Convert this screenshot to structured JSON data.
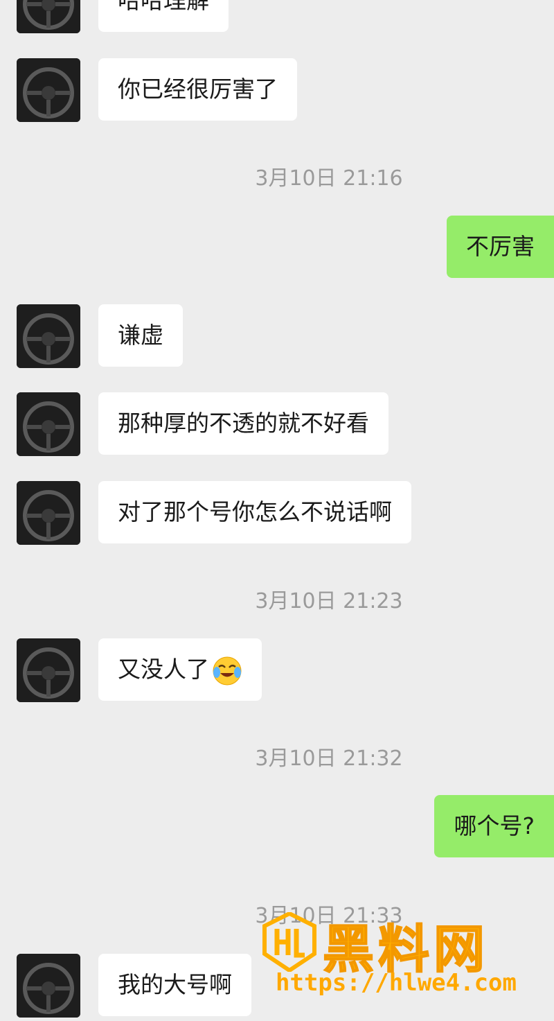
{
  "messages": [
    {
      "side": "other",
      "text": "哈哈理解"
    },
    {
      "side": "other",
      "text": "你已经很厉害了"
    },
    {
      "side": "time",
      "text": "3月10日 21:16"
    },
    {
      "side": "self",
      "text": "不厉害"
    },
    {
      "side": "other",
      "text": "谦虚"
    },
    {
      "side": "other",
      "text": "那种厚的不透的就不好看"
    },
    {
      "side": "other",
      "text": "对了那个号你怎么不说话啊"
    },
    {
      "side": "time",
      "text": "3月10日 21:23"
    },
    {
      "side": "other",
      "text": "又没人了",
      "emoji": "crying-laughing-emoji"
    },
    {
      "side": "time",
      "text": "3月10日 21:32"
    },
    {
      "side": "self",
      "text": "哪个号?"
    },
    {
      "side": "time",
      "text": "3月10日 21:33"
    },
    {
      "side": "other",
      "text": "我的大号啊"
    }
  ],
  "watermark": {
    "title": "黑料网",
    "url": "https://hlwe4.com",
    "logo_icon": "hl-shield-logo-icon"
  },
  "colors": {
    "background": "#ededed",
    "self_bubble": "#95ec69",
    "other_bubble": "#ffffff",
    "timestamp": "#9a9a9a",
    "watermark": "#ffb000"
  }
}
